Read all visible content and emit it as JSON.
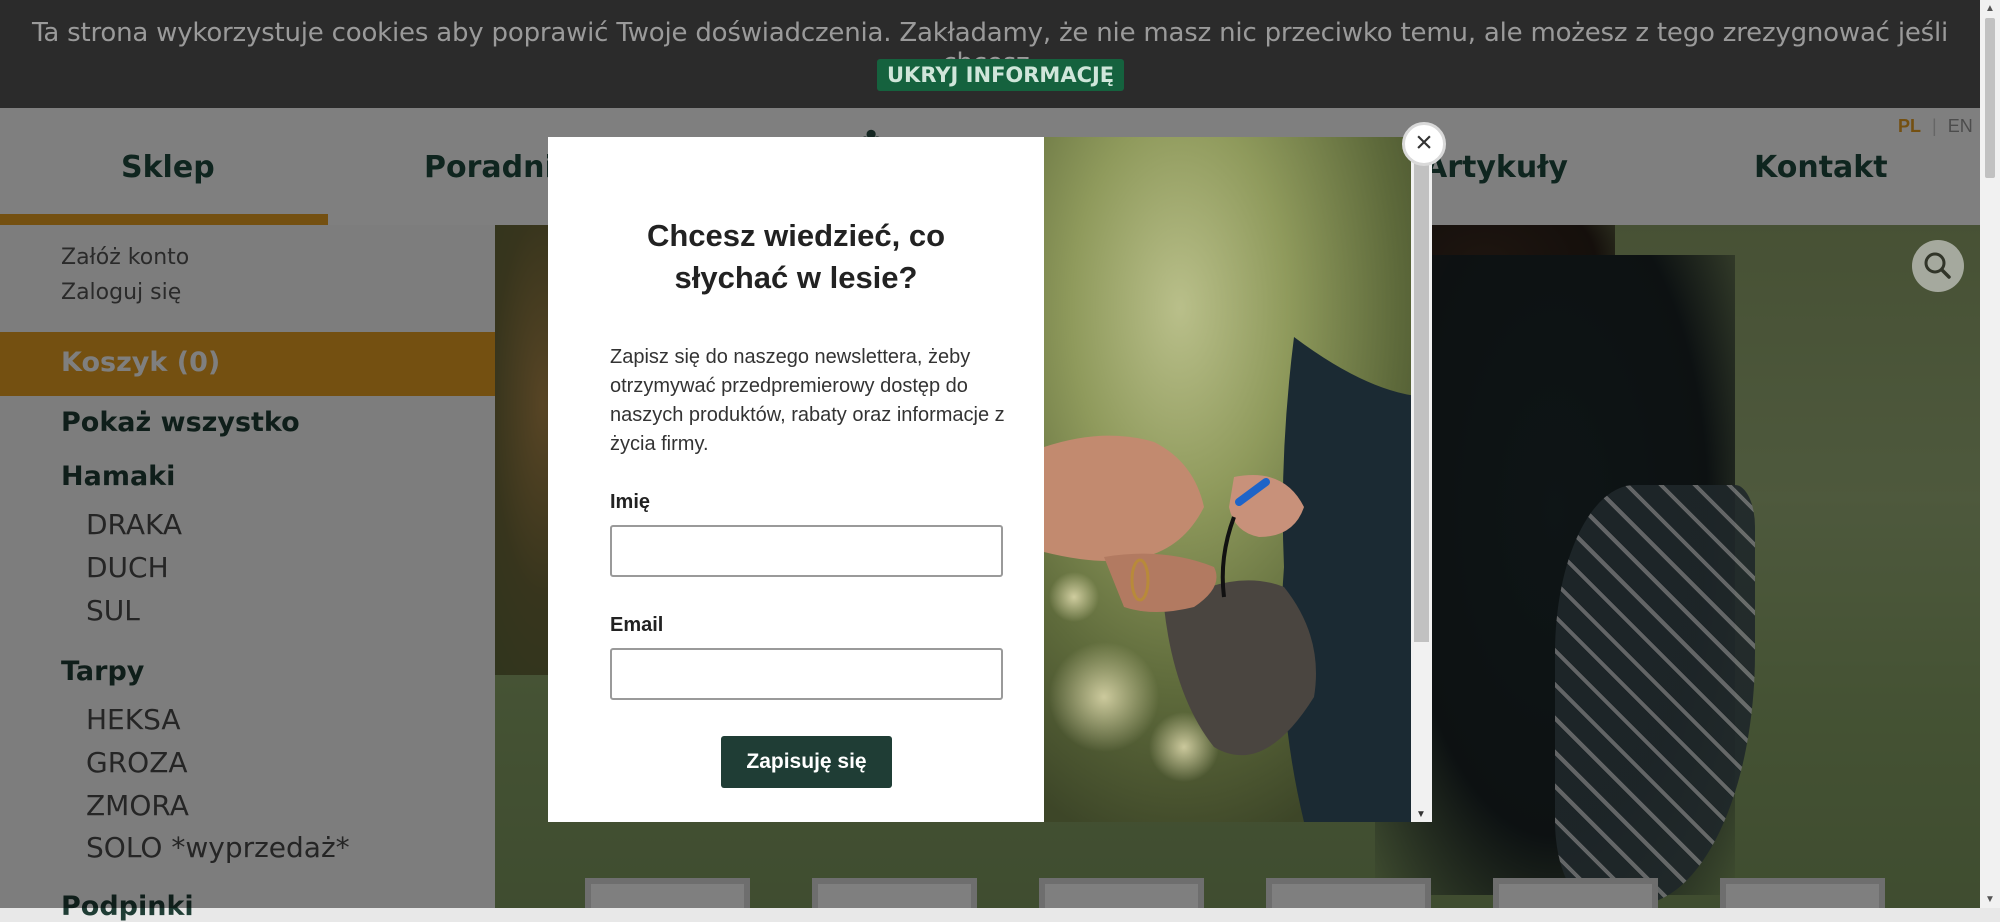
{
  "cookie": {
    "text": "Ta strona wykorzystuje cookies aby poprawić Twoje doświadczenia. Zakładamy, że nie masz nic przeciwko temu, ale możesz z tego zrezygnować jeśli chcesz.",
    "hide_label": "UKRYJ INFORMACJĘ"
  },
  "nav": {
    "items": [
      "Sklep",
      "Poradnik",
      "Artykuły",
      "Kontakt"
    ],
    "active_color": "#e8a022"
  },
  "lang": {
    "pl": "PL",
    "sep": "|",
    "en": "EN"
  },
  "account": {
    "register": "Załóż konto",
    "login": "Zaloguj się"
  },
  "cart": {
    "label": "Koszyk (0)"
  },
  "categories": {
    "show_all": "Pokaż wszystko",
    "hamaki": {
      "label": "Hamaki",
      "items": [
        "DRAKA",
        "DUCH",
        "SUL"
      ]
    },
    "tarpy": {
      "label": "Tarpy",
      "items": [
        "HEKSA",
        "GROZA",
        "ZMORA",
        "SOLO *wyprzedaż*"
      ]
    },
    "podpinki": {
      "label": "Podpinki"
    }
  },
  "modal": {
    "title": "Chcesz wiedzieć, co słychać w lesie?",
    "description": "Zapisz się do naszego newslettera, żeby otrzymywać przedpremierowy dostęp do naszych produktów, rabaty oraz informacje z życia firmy.",
    "name_label": "Imię",
    "name_value": "",
    "email_label": "Email",
    "email_value": "",
    "submit_label": "Zapisuję się",
    "close_glyph": "×"
  },
  "icons": {
    "search": "search-icon",
    "close": "close-icon"
  },
  "colors": {
    "brand_orange": "#e8a022",
    "brand_green": "#1f3d35",
    "cookie_button": "#15623e"
  }
}
